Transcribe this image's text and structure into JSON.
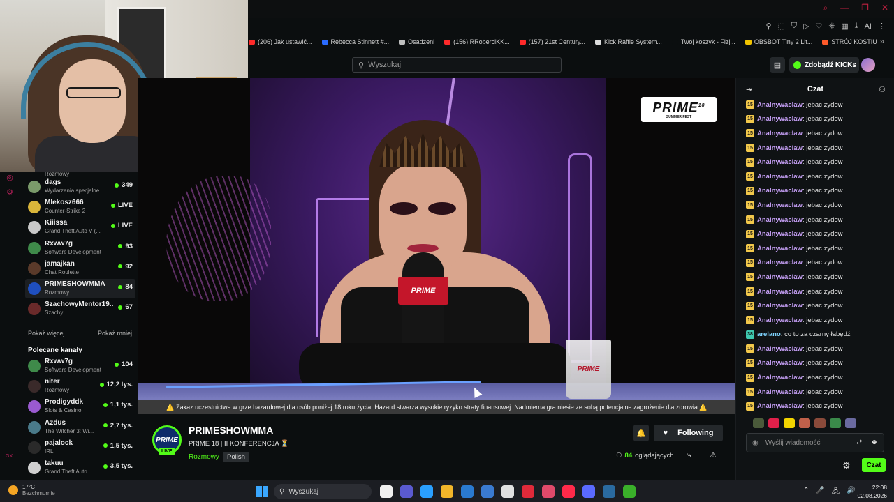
{
  "window": {
    "controls": [
      "⌕",
      "—",
      "❐",
      "✕"
    ],
    "toolbar_icons": [
      "⚲",
      "⬚",
      "⛉",
      "▷",
      "♡",
      "⎈",
      "▦",
      "⤓",
      "AI",
      "⋮"
    ]
  },
  "bookmarks": [
    {
      "label": "(206) Jak ustawić...",
      "color": "#ff2a2a"
    },
    {
      "label": "Rebecca Stinnett #...",
      "color": "#2a6bff"
    },
    {
      "label": "Osadzeni",
      "color": "#bfbfbf"
    },
    {
      "label": "(156) RRoberciKK...",
      "color": "#ff2a2a"
    },
    {
      "label": "(157) 21st Century...",
      "color": "#ff2a2a"
    },
    {
      "label": "Kick Raffle System...",
      "color": "#dddddd"
    },
    {
      "label": "Twój koszyk - Fizj...",
      "color": "#0b0e0f"
    },
    {
      "label": "OBSBOT Tiny 2 Lit...",
      "color": "#f2c400"
    },
    {
      "label": "STRÓJ KOSTIUM...",
      "color": "#ff5a2a"
    }
  ],
  "bookmarks_more": "»",
  "header": {
    "search_placeholder": "Wyszukaj",
    "search_icon": "⚲",
    "layout_icon": "▤",
    "kicks_label": "Zdobądź KICKs"
  },
  "sidebar": {
    "first_sub": "Rozmowy",
    "rail_icons": [
      "◎",
      "⚙"
    ],
    "followed": [
      {
        "name": "dags",
        "sub": "Wydarzenia specjalne",
        "count": "349",
        "avatar": "#7a9a6a"
      },
      {
        "name": "Mlekosz666",
        "sub": "Counter-Strike 2",
        "count": "LIVE",
        "avatar": "#d9b53a"
      },
      {
        "name": "Kiiissa",
        "sub": "Grand Theft Auto V (...",
        "count": "LIVE",
        "avatar": "#c9c9c9"
      },
      {
        "name": "Rxww7g",
        "sub": "Software Development",
        "count": "93",
        "avatar": "#3f8a4a"
      },
      {
        "name": "jamajkan",
        "sub": "Chat Roulette",
        "count": "92",
        "avatar": "#5a3a2a"
      },
      {
        "name": "PRIMESHOWMMA",
        "sub": "Rozmowy",
        "count": "84",
        "avatar": "#1f4fbf"
      },
      {
        "name": "SzachowyMentor19...",
        "sub": "Szachy",
        "count": "67",
        "avatar": "#6a2a2a"
      }
    ],
    "show_more": "Pokaż więcej",
    "show_less": "Pokaż mniej",
    "recommended_title": "Polecane kanały",
    "recommended": [
      {
        "name": "Rxww7g",
        "sub": "Software Development",
        "count": "104",
        "avatar": "#3f8a4a"
      },
      {
        "name": "niter",
        "sub": "Rozmowy",
        "count": "12,2 tys.",
        "avatar": "#3a2a2a"
      },
      {
        "name": "Prodigyddk",
        "sub": "Slots & Casino",
        "count": "1,1 tys.",
        "avatar": "#9a5ad0"
      },
      {
        "name": "Azdus",
        "sub": "The Witcher 3: Wi...",
        "count": "2,7 tys.",
        "avatar": "#4a7a8a"
      },
      {
        "name": "pajalock",
        "sub": "IRL",
        "count": "1,5 tys.",
        "avatar": "#2a2a2a"
      },
      {
        "name": "takuu",
        "sub": "Grand Theft Auto ...",
        "count": "3,5 tys.",
        "avatar": "#d0d0d0"
      }
    ],
    "rail_bottom": "GX",
    "rail_bottom2": "···"
  },
  "video": {
    "warning": "⚠️ Zakaz uczestnictwa w grze hazardowej dla osób poniżej 18 roku życia. Hazard stwarza wysokie ryzyko straty finansowej. Nadmierna gra niesie ze sobą potencjalne zagrożenie dla zdrowia ⚠️",
    "overlay_logo": "PRIME",
    "overlay_sup": "18",
    "overlay_sub": "SUMMER FEST",
    "mic_logo": "PRIME",
    "glass_logo": "PRIME"
  },
  "stream": {
    "avatar_text": "PRIME",
    "live_badge": "LIVE",
    "channel_name": "PRIMESHOWMMA",
    "title": "PRIME 18 | II KONFERENCJA ⏳",
    "category": "Rozmowy",
    "tag": "Polish",
    "bell_icon": "🔔",
    "following_label": "Following",
    "heart_icon": "♥",
    "viewers_count": "84",
    "viewers_label": "oglądających",
    "viewers_icon": "⚇",
    "share_icon": "⤷",
    "report_icon": "⚠"
  },
  "chat": {
    "title": "Czat",
    "collapse_icon": "⇥",
    "users_icon": "⚇",
    "messages": [
      {
        "badge": "15",
        "user": "Analnywaclaw",
        "text": ": jebac zydow"
      },
      {
        "badge": "15",
        "user": "Analnywaclaw",
        "text": ": jebac zydow"
      },
      {
        "badge": "15",
        "user": "Analnywaclaw",
        "text": ": jebac zydow"
      },
      {
        "badge": "15",
        "user": "Analnywaclaw",
        "text": ": jebac zydow"
      },
      {
        "badge": "15",
        "user": "Analnywaclaw",
        "text": ": jebac zydow"
      },
      {
        "badge": "15",
        "user": "Analnywaclaw",
        "text": ": jebac zydow"
      },
      {
        "badge": "15",
        "user": "Analnywaclaw",
        "text": ": jebac zydow"
      },
      {
        "badge": "15",
        "user": "Analnywaclaw",
        "text": ": jebac zydow"
      },
      {
        "badge": "15",
        "user": "Analnywaclaw",
        "text": ": jebac zydow"
      },
      {
        "badge": "15",
        "user": "Analnywaclaw",
        "text": ": jebac zydow"
      },
      {
        "badge": "15",
        "user": "Analnywaclaw",
        "text": ": jebac zydow"
      },
      {
        "badge": "15",
        "user": "Analnywaclaw",
        "text": ": jebac zydow"
      },
      {
        "badge": "15",
        "user": "Analnywaclaw",
        "text": ": jebac zydow"
      },
      {
        "badge": "15",
        "user": "Analnywaclaw",
        "text": ": jebac zydow"
      },
      {
        "badge": "15",
        "user": "Analnywaclaw",
        "text": ": jebac zydow"
      },
      {
        "badge": "15",
        "user": "Analnywaclaw",
        "text": ": jebac zydow"
      },
      {
        "badge": "38",
        "user": "arelano",
        "text": ": co to za czarny łabędź",
        "teal": true
      },
      {
        "badge": "15",
        "user": "Analnywaclaw",
        "text": ": jebac zydow"
      },
      {
        "badge": "15",
        "user": "Analnywaclaw",
        "text": ": jebac zydow"
      },
      {
        "badge": "15",
        "user": "Analnywaclaw",
        "text": ": jebac zydow"
      },
      {
        "badge": "15",
        "user": "Analnywaclaw",
        "text": ": jebac zydow"
      },
      {
        "badge": "15",
        "user": "Analnywaclaw",
        "text": ": jebac zydow"
      }
    ],
    "emotes": [
      "#4a5a3a",
      "#e0204a",
      "#f2d400",
      "#c0604a",
      "#8a4a3a",
      "#3a8a4a",
      "#6a6aa0"
    ],
    "input_placeholder": "Wyślij wiadomość",
    "input_icon": "◉",
    "translate_icon": "⇄",
    "emoji_icon": "☻",
    "settings_icon": "⚙",
    "send_label": "Czat"
  },
  "taskbar": {
    "temp": "17°C",
    "weather": "Bezchmurnie",
    "search_label": "Wyszukaj",
    "search_icon": "⚲",
    "apps": [
      "#f0f0f0",
      "#5a5ad0",
      "#2aa0ff",
      "#f2b62a",
      "#2a7ad0",
      "#3a7ad0",
      "#e0e0e0",
      "#e02a3a",
      "#e04a6a",
      "#ff2a4a",
      "#5a6aff",
      "#2a6aa0",
      "#3ab02a"
    ],
    "tray": [
      "⌃",
      "🎤",
      "🖧",
      "🔊"
    ],
    "time": "22:08",
    "date": "02.08.2026"
  }
}
